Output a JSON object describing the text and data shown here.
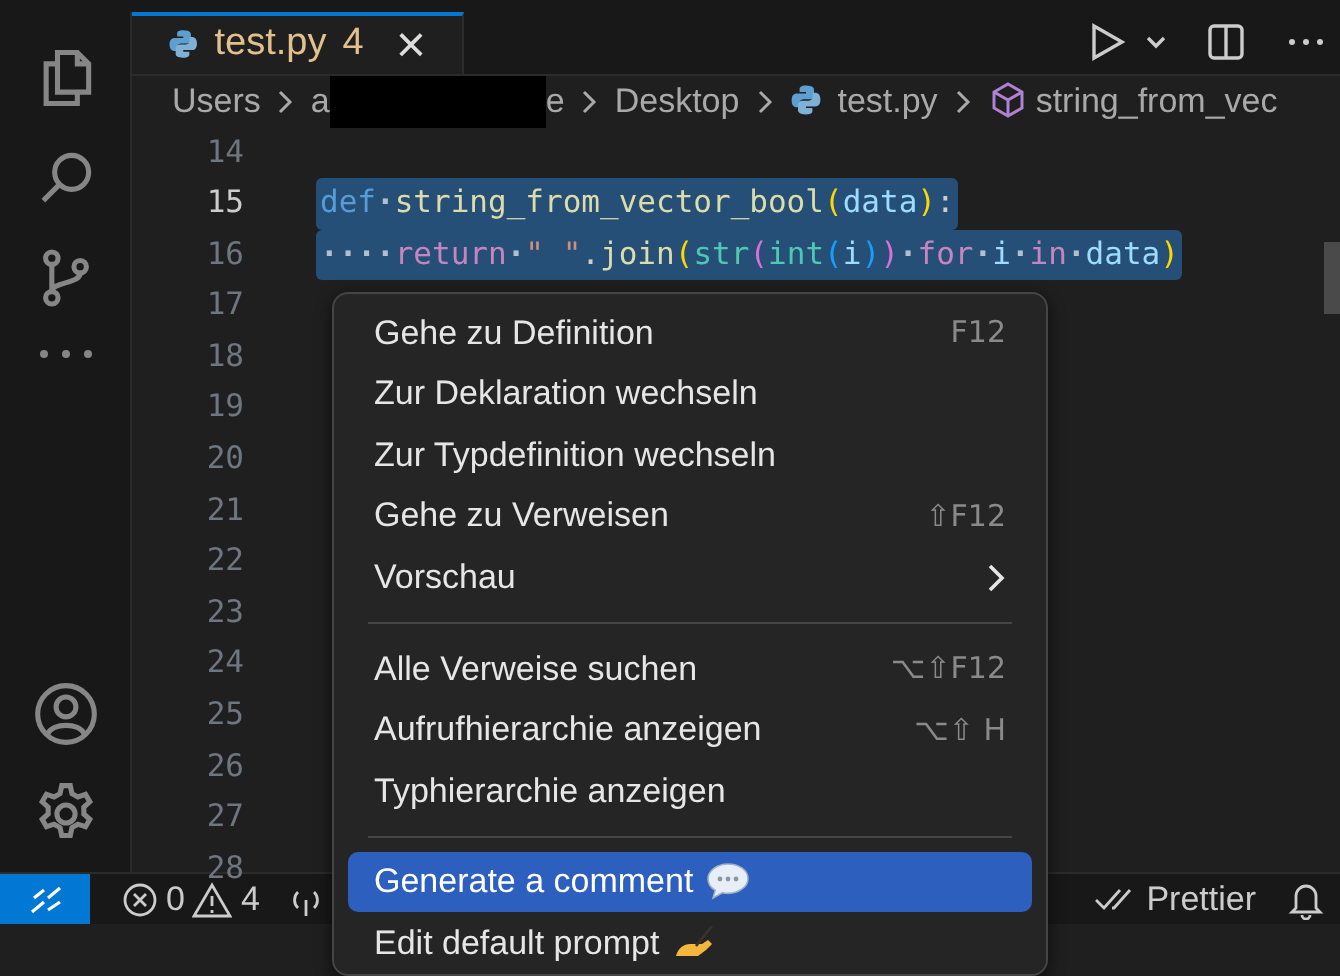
{
  "tab": {
    "label": "test.py",
    "problems": "4",
    "close": "×",
    "selected": true
  },
  "breadcrumbs": [
    {
      "kind": "text",
      "label": "Users"
    },
    {
      "kind": "redacted",
      "start": "a",
      "end": "e"
    },
    {
      "kind": "text",
      "label": "Desktop"
    },
    {
      "kind": "file",
      "label": "test.py"
    },
    {
      "kind": "symbol",
      "label": "string_from_vec"
    }
  ],
  "code_lines": [
    {
      "number": "14",
      "current": false
    },
    {
      "number": "15",
      "current": true,
      "selected": true,
      "tokens": [
        {
          "kind": "keyword",
          "text": "def"
        },
        {
          "kind": "ws",
          "text": "·"
        },
        {
          "kind": "function",
          "text": "string_from_vector_bool"
        },
        {
          "kind": "bracket",
          "text": "("
        },
        {
          "kind": "variable",
          "text": "data"
        },
        {
          "kind": "bracket",
          "text": ")"
        },
        {
          "kind": "plain",
          "text": ":"
        }
      ]
    },
    {
      "number": "16",
      "current": false,
      "selected": true,
      "tokens": [
        {
          "kind": "ws",
          "text": "····"
        },
        {
          "kind": "control",
          "text": "return"
        },
        {
          "kind": "ws",
          "text": "·"
        },
        {
          "kind": "string",
          "text": "\" \""
        },
        {
          "kind": "plain",
          "text": "."
        },
        {
          "kind": "function",
          "text": "join"
        },
        {
          "kind": "bracket",
          "text": "("
        },
        {
          "kind": "type",
          "text": "str"
        },
        {
          "kind": "bracket2",
          "text": "("
        },
        {
          "kind": "type",
          "text": "int"
        },
        {
          "kind": "bracket3",
          "text": "("
        },
        {
          "kind": "variable",
          "text": "i"
        },
        {
          "kind": "bracket3",
          "text": ")"
        },
        {
          "kind": "bracket2",
          "text": ")"
        },
        {
          "kind": "ws",
          "text": "·"
        },
        {
          "kind": "control",
          "text": "for"
        },
        {
          "kind": "ws",
          "text": "·"
        },
        {
          "kind": "variable",
          "text": "i"
        },
        {
          "kind": "ws",
          "text": "·"
        },
        {
          "kind": "control",
          "text": "in"
        },
        {
          "kind": "ws",
          "text": "·"
        },
        {
          "kind": "variable",
          "text": "data"
        },
        {
          "kind": "bracket",
          "text": ")"
        }
      ]
    },
    {
      "number": "17",
      "current": false
    },
    {
      "number": "18",
      "current": false
    },
    {
      "number": "19",
      "current": false
    },
    {
      "number": "20",
      "current": false
    },
    {
      "number": "21",
      "current": false
    },
    {
      "number": "22",
      "current": false
    },
    {
      "number": "23",
      "current": false
    },
    {
      "number": "24",
      "current": false
    },
    {
      "number": "25",
      "current": false
    },
    {
      "number": "26",
      "current": false
    },
    {
      "number": "27",
      "current": false
    },
    {
      "number": "28",
      "current": false
    }
  ],
  "context_menu": [
    {
      "kind": "item",
      "label": "Gehe zu Definition",
      "shortcut": "F12",
      "selected": false
    },
    {
      "kind": "item",
      "label": "Zur Deklaration wechseln",
      "selected": false
    },
    {
      "kind": "item",
      "label": "Zur Typdefinition wechseln",
      "selected": false
    },
    {
      "kind": "item",
      "label": "Gehe zu Verweisen",
      "shortcut": "⇧F12",
      "selected": false
    },
    {
      "kind": "submenu",
      "label": "Vorschau",
      "selected": false
    },
    {
      "kind": "separator"
    },
    {
      "kind": "item",
      "label": "Alle Verweise suchen",
      "shortcut": "⌥⇧F12",
      "selected": false
    },
    {
      "kind": "item",
      "label": "Aufrufhierarchie anzeigen",
      "shortcut": "⌥⇧ H",
      "selected": false
    },
    {
      "kind": "item",
      "label": "Typhierarchie anzeigen",
      "selected": false
    },
    {
      "kind": "separator"
    },
    {
      "kind": "comment",
      "label": "Generate a comment",
      "selected": true
    },
    {
      "kind": "prompt",
      "label": "Edit default prompt",
      "selected": false
    }
  ],
  "status_bar": {
    "errors": "0",
    "warnings": "4",
    "formatter": "Prettier"
  }
}
